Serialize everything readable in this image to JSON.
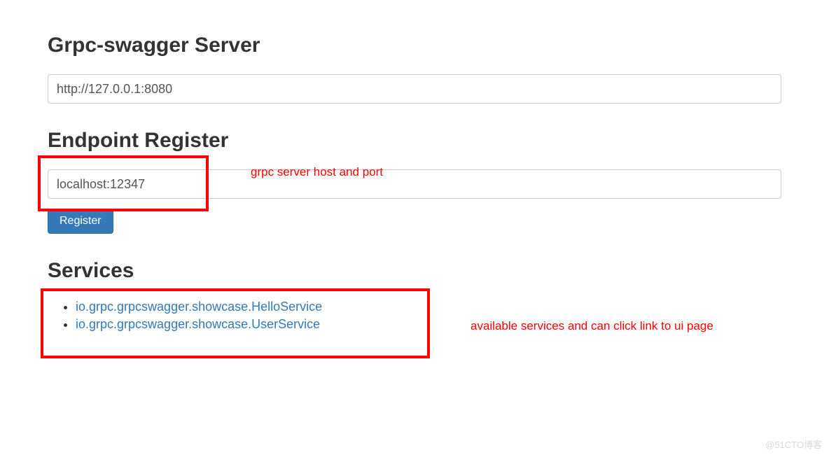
{
  "header": {
    "title": "Grpc-swagger Server",
    "server_url": "http://127.0.0.1:8080"
  },
  "endpoint": {
    "section_title": "Endpoint Register",
    "input_value": "localhost:12347",
    "register_label": "Register"
  },
  "services": {
    "section_title": "Services",
    "items": [
      "io.grpc.grpcswagger.showcase.HelloService",
      "io.grpc.grpcswagger.showcase.UserService"
    ]
  },
  "annotations": {
    "endpoint_hint": "grpc server host and port",
    "services_hint": "available services and can click link to ui page"
  },
  "watermark": "@51CTO博客"
}
